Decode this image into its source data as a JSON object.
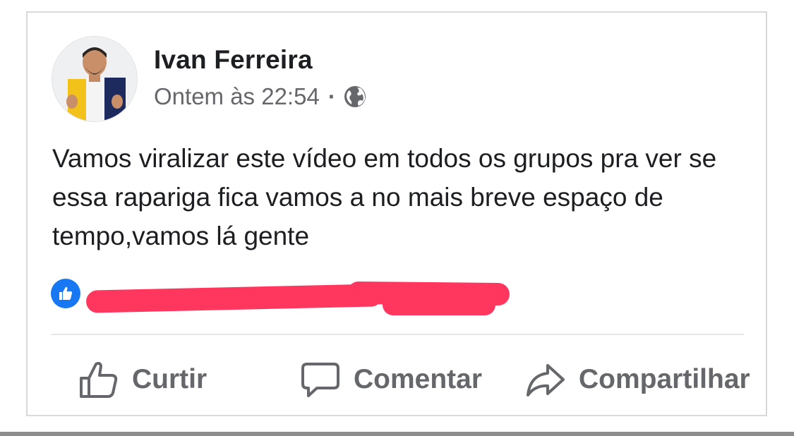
{
  "post": {
    "author": "Ivan Ferreira",
    "timestamp": "Ontem às 22:54",
    "separator": "·",
    "privacy_icon": "globe-icon",
    "text": "Vamos viralizar este vídeo em todos os grupos pra ver se essa rapariga fica vamos a no mais breve espaço de tempo,vamos lá gente"
  },
  "reactions": {
    "icon": "like-badge-icon",
    "names_redacted": true,
    "redaction_color": "#ff375f",
    "like_color": "#1877f2"
  },
  "actions": [
    {
      "label": "Curtir",
      "icon": "thumbs-up-icon"
    },
    {
      "label": "Comentar",
      "icon": "comment-icon"
    },
    {
      "label": "Compartilhar",
      "icon": "share-icon"
    }
  ]
}
